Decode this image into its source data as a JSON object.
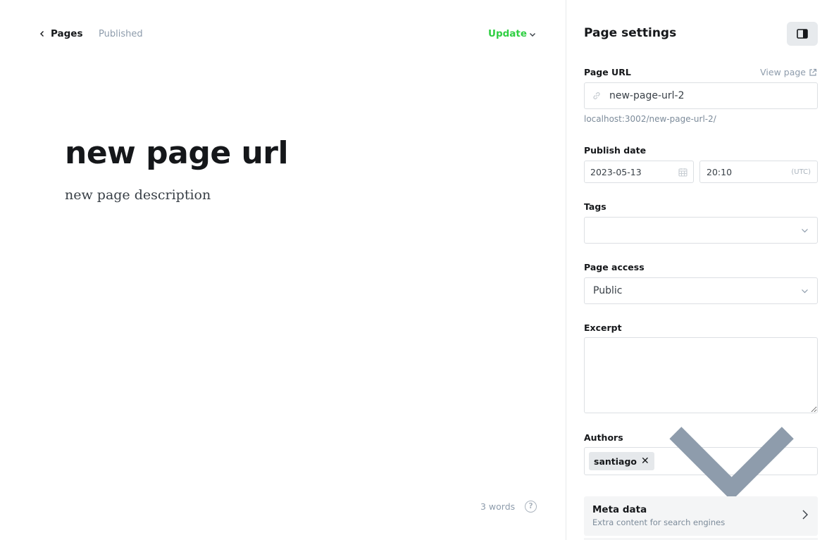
{
  "editor": {
    "back_label": "Pages",
    "status": "Published",
    "update_label": "Update",
    "post_title": "new page url",
    "post_description": "new page description",
    "word_count": "3 words",
    "help_glyph": "?"
  },
  "settings": {
    "title": "Page settings",
    "url_label": "Page URL",
    "view_page_label": "View page",
    "url_value": "new-page-url-2",
    "url_hint": "localhost:3002/new-page-url-2/",
    "publish_date_label": "Publish date",
    "date_value": "2023-05-13",
    "time_value": "20:10",
    "timezone": "(UTC)",
    "tags_label": "Tags",
    "access_label": "Page access",
    "access_value": "Public",
    "excerpt_label": "Excerpt",
    "authors_label": "Authors",
    "authors": [
      "santiago"
    ],
    "author_remove_glyph": "✕",
    "meta_title": "Meta data",
    "meta_subtitle": "Extra content for search engines"
  },
  "icons": [
    "chevron-left-icon",
    "chevron-down-icon",
    "sidebar-toggle-icon",
    "external-link-icon",
    "link-icon",
    "calendar-icon",
    "chevron-right-icon",
    "help-icon"
  ],
  "colors": {
    "accent_green": "#30cf43",
    "muted_text": "#8e9cac",
    "border": "#dcdfe3",
    "panel_button_bg": "#e7eaed",
    "meta_bg": "#f4f5f6"
  }
}
